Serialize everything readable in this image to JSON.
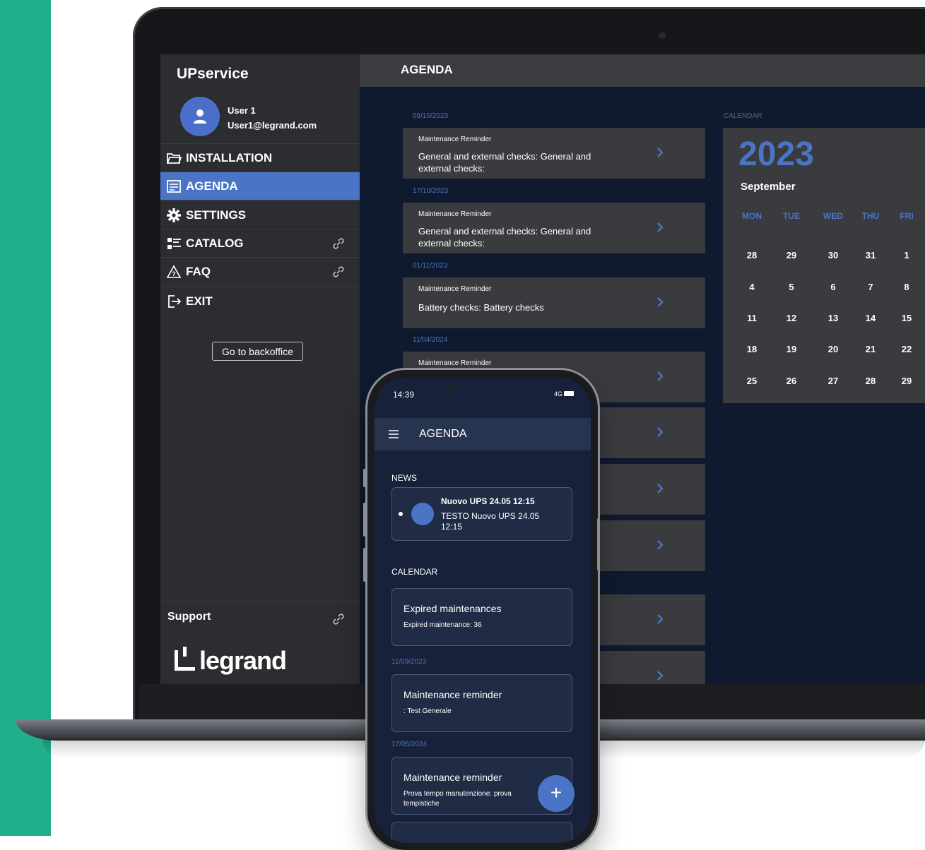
{
  "laptop": {
    "sidebar": {
      "app_title": "UPservice",
      "user_name": "User 1",
      "user_email": "User1@legrand.com",
      "items": [
        {
          "label": "INSTALLATION",
          "icon": "folder-icon"
        },
        {
          "label": "AGENDA",
          "icon": "agenda-icon",
          "active": true
        },
        {
          "label": "SETTINGS",
          "icon": "gear-icon"
        },
        {
          "label": "CATALOG",
          "icon": "catalog-icon",
          "external": true
        },
        {
          "label": "FAQ",
          "icon": "warning-icon",
          "external": true
        },
        {
          "label": "EXIT",
          "icon": "exit-icon"
        }
      ],
      "backoffice_button": "Go to backoffice",
      "support_label": "Support",
      "logo_text": "legrand"
    },
    "header": {
      "title": "AGENDA"
    },
    "events": [
      {
        "date": "09/10/2023",
        "type": "Maintenance Reminder",
        "desc": "General and external checks: General and external checks:"
      },
      {
        "date": "17/10/2023",
        "type": "Maintenance Reminder",
        "desc": "General and external checks: General and external checks:"
      },
      {
        "date": "01/11/2023",
        "type": "Maintenance Reminder",
        "desc": "Battery checks: Battery checks"
      },
      {
        "date": "11/04/2024",
        "type": "Maintenance Reminder",
        "desc": ""
      }
    ],
    "calendar": {
      "section_label": "CALENDAR",
      "year": "2023",
      "month": "September",
      "weekdays": [
        "MON",
        "TUE",
        "WED",
        "THU",
        "FRI"
      ],
      "weeks": [
        [
          "28",
          "29",
          "30",
          "31",
          "1"
        ],
        [
          "4",
          "5",
          "6",
          "7",
          "8"
        ],
        [
          "11",
          "12",
          "13",
          "14",
          "15"
        ],
        [
          "18",
          "19",
          "20",
          "21",
          "22"
        ],
        [
          "25",
          "26",
          "27",
          "28",
          "29"
        ]
      ]
    }
  },
  "phone": {
    "status_time": "14:39",
    "status_network": "4G",
    "title": "AGENDA",
    "news_label": "NEWS",
    "news": {
      "title": "Nuovo UPS 24.05 12:15",
      "text": "TESTO Nuovo UPS 24.05 12:15"
    },
    "calendar_label": "CALENDAR",
    "expired": {
      "title": "Expired maintenances",
      "sub": "Expired maintenance: 36"
    },
    "items": [
      {
        "date": "11/09/2023",
        "title": "Maintenance reminder",
        "sub": ": Test Generale"
      },
      {
        "date": "17/05/2024",
        "title": "Maintenance reminder",
        "sub": "Prova tempo manutenzione: prova tempistiche"
      }
    ],
    "fab_label": "+"
  },
  "colors": {
    "accent": "#4a74c6",
    "brand_green": "#20ae8b",
    "sidebar_bg": "#2c2d30",
    "screen_bg": "#0f1a2e"
  }
}
